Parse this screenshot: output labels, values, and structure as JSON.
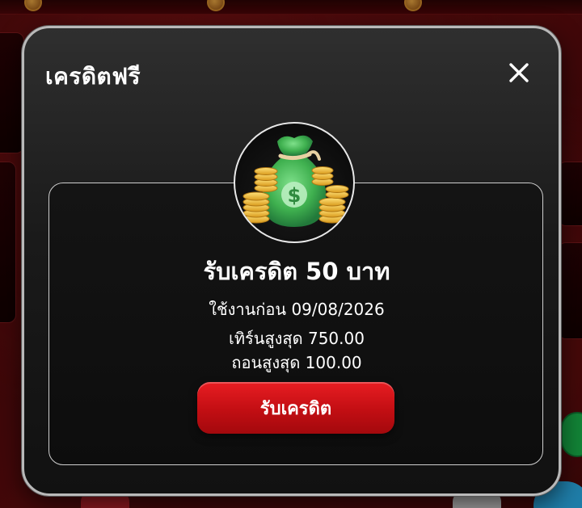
{
  "modal": {
    "title": "เครดิตฟรี",
    "close_label": "close"
  },
  "offer": {
    "headline": "รับเครดิต 50 บาท",
    "valid_until": "ใช้งานก่อน 09/08/2026",
    "max_turnover": "เทิร์นสูงสุด 750.00",
    "max_withdraw": "ถอนสูงสุด 100.00",
    "claim_label": "รับเครดิต",
    "image_icon": "money-bag-icon"
  },
  "colors": {
    "accent_red": "#d0151a",
    "modal_bg": "#1a1a1a",
    "text": "#ffffff",
    "border": "#b9b9b9"
  }
}
